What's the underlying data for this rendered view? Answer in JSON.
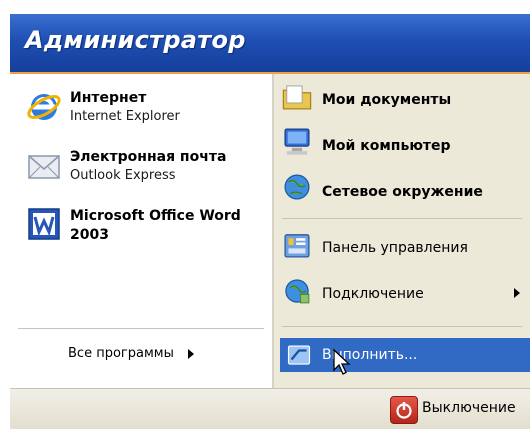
{
  "header": {
    "user_name": "Администратор"
  },
  "left_pinned": [
    {
      "name": "Интернет",
      "sub": "Internet Explorer",
      "icon": "ie-icon"
    },
    {
      "name": "Электронная почта",
      "sub": "Outlook Express",
      "icon": "mail-icon"
    },
    {
      "name": "Microsoft Office Word",
      "sub": "2003",
      "icon": "word-icon"
    }
  ],
  "left_bottom": {
    "all_programs_label": "Все программы"
  },
  "right_items": [
    {
      "label": "Мои документы",
      "icon": "folder-icon"
    },
    {
      "label": "Мой компьютер",
      "icon": "computer-icon"
    },
    {
      "label": "Сетевое окружение",
      "icon": "network-icon"
    },
    {
      "label": "Панель управления",
      "icon": "control-panel-icon"
    },
    {
      "label": "Подключение",
      "icon": "connection-icon"
    },
    {
      "label": "Выполнить...",
      "icon": "run-icon"
    }
  ],
  "footer": {
    "shutdown_label": "Выключение"
  }
}
